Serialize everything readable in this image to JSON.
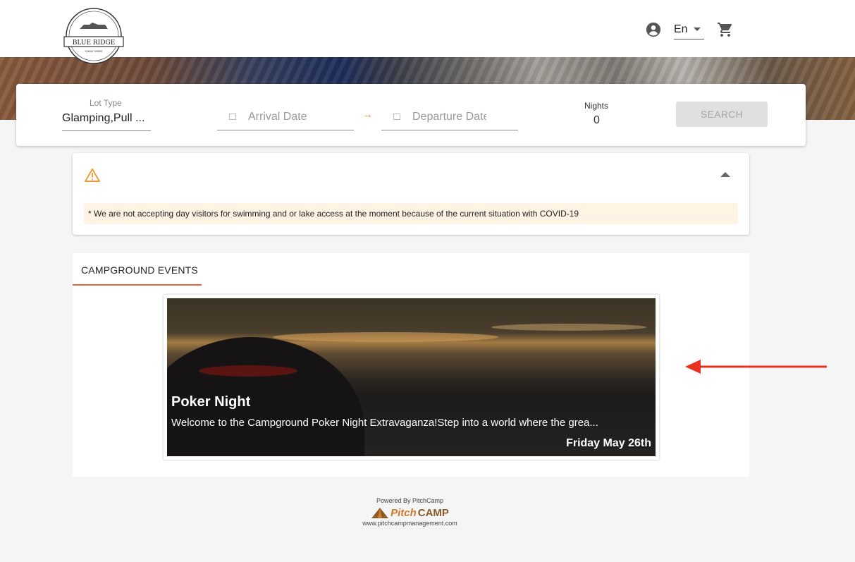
{
  "header": {
    "logo": {
      "name": "BLUE RIDGE",
      "arc_text": "GUESTHOUSE & CAMPING",
      "sub_text": "FAMILY FARMS"
    },
    "language": "En",
    "icons": [
      "account-circle-icon",
      "cart-icon"
    ]
  },
  "search": {
    "lot_type_label": "Lot Type",
    "lot_type_value": "Glamping,Pull ...",
    "arrival_placeholder": "Arrival Date",
    "departure_placeholder": "Departure Date",
    "nights_label": "Nights",
    "nights_value": "0",
    "search_label": "SEARCH"
  },
  "notice": {
    "text": "* We are not accepting day visitors for swimming and or lake access at the moment because of the current situation with COVID-19"
  },
  "events": {
    "tab_label": "CAMPGROUND EVENTS",
    "items": [
      {
        "title": "Poker Night",
        "description": "Welcome to the Campground Poker Night Extravaganza!Step into a world where the grea...",
        "date": "Friday May 26th"
      }
    ]
  },
  "footer": {
    "powered_by": "Powered By PitchCamp",
    "brand_pitch": "Pitch",
    "brand_camp": "CAMP",
    "url": "www.pitchcampmanagement.com"
  },
  "colors": {
    "accent": "#e8643a",
    "warning": "#f0962e",
    "notice_bg": "#fff4e4",
    "annotation_arrow": "#e8321e"
  }
}
